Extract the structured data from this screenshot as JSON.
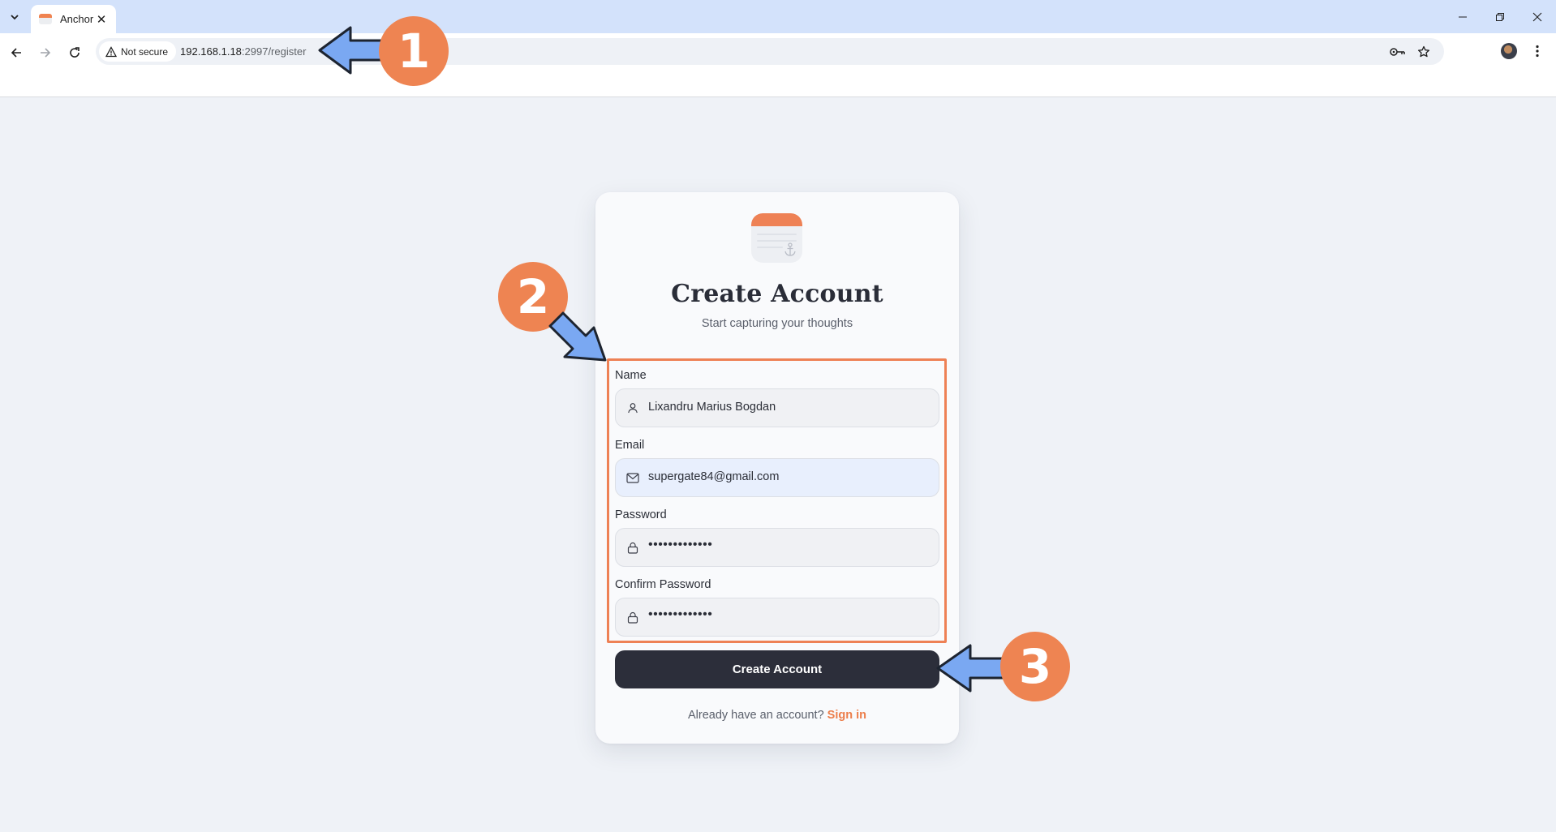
{
  "browser": {
    "tab": {
      "title": "Anchor"
    },
    "address": {
      "security_label": "Not secure",
      "host": "192.168.1.18",
      "path": ":2997/register"
    },
    "icons": [
      "tab-menu-icon",
      "close-icon",
      "minimize-icon",
      "restore-icon",
      "back-icon",
      "forward-icon",
      "reload-icon",
      "warning-icon",
      "password-key-icon",
      "star-icon",
      "kebab-menu-icon"
    ]
  },
  "page": {
    "title": "Create Account",
    "subtitle": "Start capturing your thoughts",
    "fields": [
      {
        "label": "Name",
        "value": "Lixandru Marius Bogdan",
        "icon": "user-icon"
      },
      {
        "label": "Email",
        "value": "supergate84@gmail.com",
        "icon": "mail-icon"
      },
      {
        "label": "Password",
        "value": "•••••••••••••",
        "icon": "lock-icon"
      },
      {
        "label": "Confirm Password",
        "value": "•••••••••••••",
        "icon": "lock-icon"
      }
    ],
    "submit_label": "Create Account",
    "signin_prompt": "Already have an account?",
    "signin_link": "Sign in"
  },
  "annotations": {
    "badges": [
      "1",
      "2",
      "3"
    ]
  },
  "colors": {
    "accent": "#ee8155",
    "button_dark": "#2c2e3a",
    "arrow": "#7aa8f2",
    "page_bg": "#eff2f7"
  }
}
